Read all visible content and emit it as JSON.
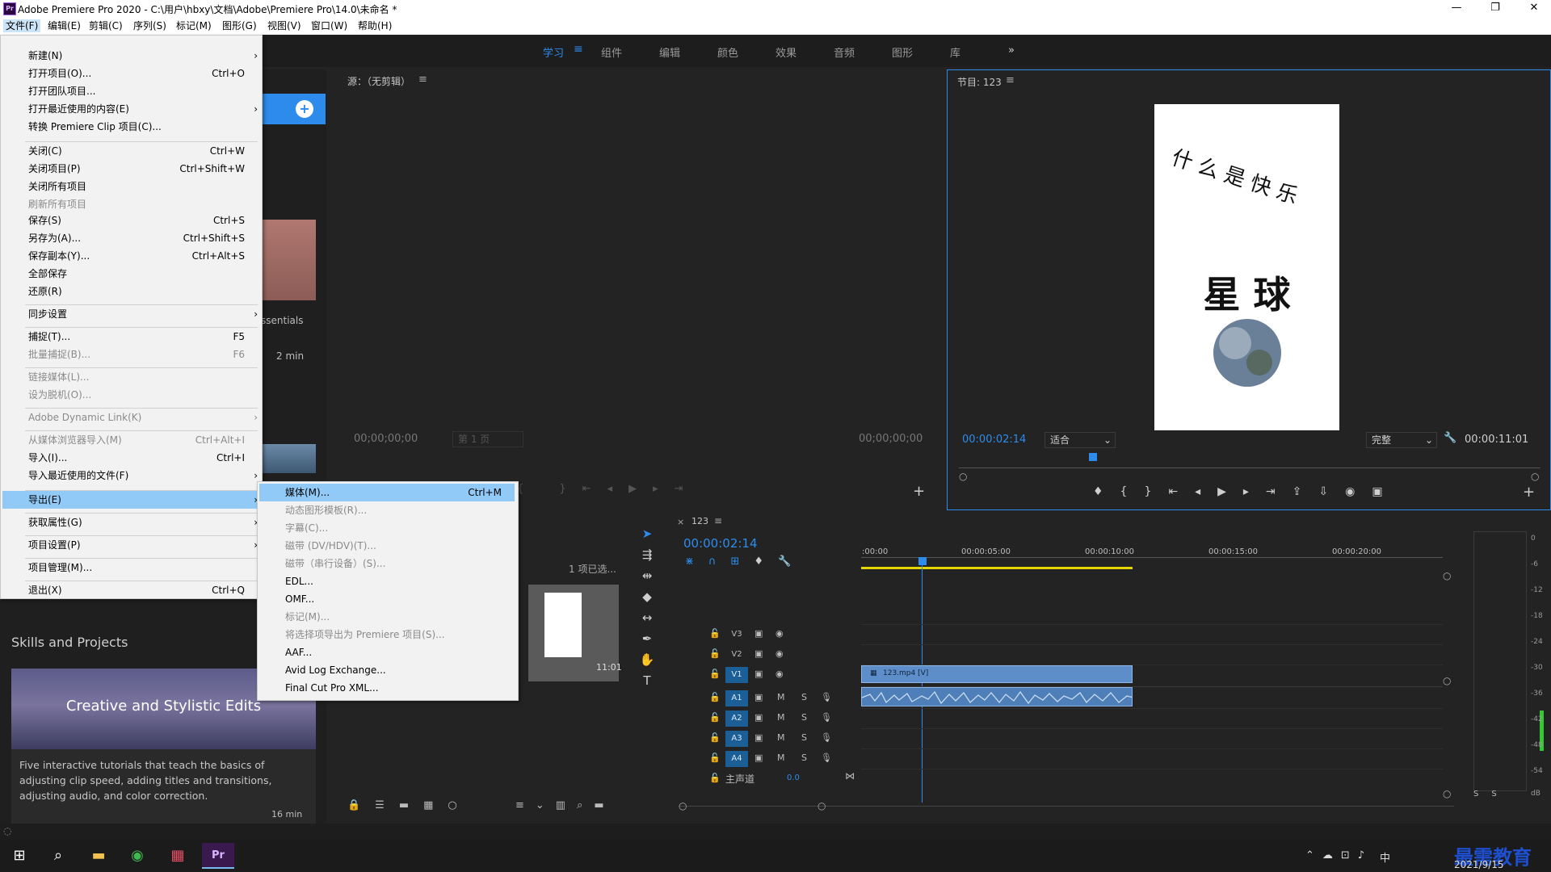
{
  "window": {
    "title": "Adobe Premiere Pro 2020 - C:\\用户\\hbxy\\文档\\Adobe\\Premiere Pro\\14.0\\未命名 *",
    "minimize": "—",
    "maximize": "❐",
    "close": "✕"
  },
  "menubar": [
    "文件(F)",
    "编辑(E)",
    "剪辑(C)",
    "序列(S)",
    "标记(M)",
    "图形(G)",
    "视图(V)",
    "窗口(W)",
    "帮助(H)"
  ],
  "workspaces": [
    "学习",
    "组件",
    "编辑",
    "颜色",
    "效果",
    "音频",
    "图形",
    "库"
  ],
  "workspace_more": "»",
  "file_menu": [
    {
      "label": "新建(N)",
      "shortcut": "",
      "submenu": true,
      "disabled": false
    },
    {
      "label": "打开项目(O)...",
      "shortcut": "Ctrl+O",
      "submenu": false,
      "disabled": false
    },
    {
      "label": "打开团队项目...",
      "shortcut": "",
      "submenu": false,
      "disabled": false
    },
    {
      "label": "打开最近使用的内容(E)",
      "shortcut": "",
      "submenu": true,
      "disabled": false
    },
    {
      "label": "转换 Premiere Clip 项目(C)...",
      "shortcut": "",
      "submenu": false,
      "disabled": false
    },
    {
      "label": "关闭(C)",
      "shortcut": "Ctrl+W",
      "submenu": false,
      "disabled": false
    },
    {
      "label": "关闭项目(P)",
      "shortcut": "Ctrl+Shift+W",
      "submenu": false,
      "disabled": false
    },
    {
      "label": "关闭所有项目",
      "shortcut": "",
      "submenu": false,
      "disabled": false
    },
    {
      "label": "刷新所有项目",
      "shortcut": "",
      "submenu": false,
      "disabled": true
    },
    {
      "label": "保存(S)",
      "shortcut": "Ctrl+S",
      "submenu": false,
      "disabled": false
    },
    {
      "label": "另存为(A)...",
      "shortcut": "Ctrl+Shift+S",
      "submenu": false,
      "disabled": false
    },
    {
      "label": "保存副本(Y)...",
      "shortcut": "Ctrl+Alt+S",
      "submenu": false,
      "disabled": false
    },
    {
      "label": "全部保存",
      "shortcut": "",
      "submenu": false,
      "disabled": false
    },
    {
      "label": "还原(R)",
      "shortcut": "",
      "submenu": false,
      "disabled": false
    },
    {
      "label": "同步设置",
      "shortcut": "",
      "submenu": true,
      "disabled": false
    },
    {
      "label": "捕捉(T)...",
      "shortcut": "F5",
      "submenu": false,
      "disabled": false
    },
    {
      "label": "批量捕捉(B)...",
      "shortcut": "F6",
      "submenu": false,
      "disabled": true
    },
    {
      "label": "链接媒体(L)...",
      "shortcut": "",
      "submenu": false,
      "disabled": true
    },
    {
      "label": "设为脱机(O)...",
      "shortcut": "",
      "submenu": false,
      "disabled": true
    },
    {
      "label": "Adobe Dynamic Link(K)",
      "shortcut": "",
      "submenu": true,
      "disabled": true
    },
    {
      "label": "从媒体浏览器导入(M)",
      "shortcut": "Ctrl+Alt+I",
      "submenu": false,
      "disabled": true
    },
    {
      "label": "导入(I)...",
      "shortcut": "Ctrl+I",
      "submenu": false,
      "disabled": false
    },
    {
      "label": "导入最近使用的文件(F)",
      "shortcut": "",
      "submenu": true,
      "disabled": false
    },
    {
      "label": "导出(E)",
      "shortcut": "",
      "submenu": true,
      "disabled": false
    },
    {
      "label": "获取属性(G)",
      "shortcut": "",
      "submenu": true,
      "disabled": false
    },
    {
      "label": "项目设置(P)",
      "shortcut": "",
      "submenu": true,
      "disabled": false
    },
    {
      "label": "项目管理(M)...",
      "shortcut": "",
      "submenu": false,
      "disabled": false
    },
    {
      "label": "退出(X)",
      "shortcut": "Ctrl+Q",
      "submenu": false,
      "disabled": false
    }
  ],
  "export_menu": [
    {
      "label": "媒体(M)...",
      "shortcut": "Ctrl+M",
      "disabled": false
    },
    {
      "label": "动态图形模板(R)...",
      "shortcut": "",
      "disabled": true
    },
    {
      "label": "字幕(C)...",
      "shortcut": "",
      "disabled": true
    },
    {
      "label": "磁带 (DV/HDV)(T)...",
      "shortcut": "",
      "disabled": true
    },
    {
      "label": "磁带（串行设备）(S)...",
      "shortcut": "",
      "disabled": true
    },
    {
      "label": "EDL...",
      "shortcut": "",
      "disabled": false
    },
    {
      "label": "OMF...",
      "shortcut": "",
      "disabled": false
    },
    {
      "label": "标记(M)...",
      "shortcut": "",
      "disabled": true
    },
    {
      "label": "将选择项导出为 Premiere 项目(S)...",
      "shortcut": "",
      "disabled": true
    },
    {
      "label": "AAF...",
      "shortcut": "",
      "disabled": false
    },
    {
      "label": "Avid Log Exchange...",
      "shortcut": "",
      "disabled": false
    },
    {
      "label": "Final Cut Pro XML...",
      "shortcut": "",
      "disabled": false
    }
  ],
  "learn_panel": {
    "essentials_fragment": "ssentials",
    "duration_fragment": "2 min",
    "section_title": "Skills and Projects",
    "card_title": "Creative and Stylistic Edits",
    "card_desc": "Five interactive tutorials that teach the basics of adjusting clip speed, adding titles and transitions, adjusting audio, and color correction.",
    "card_duration": "16 min"
  },
  "source_monitor": {
    "title": "源：（无剪辑）",
    "tc_left": "00;00;00;00",
    "page": "第 1 页",
    "tc_right": "00;00;00;00"
  },
  "program_monitor": {
    "title": "节目: 123",
    "timecode": "00:00:02:14",
    "fit": "适合",
    "quality": "完整",
    "duration": "00:00:11:01",
    "frame_text_top": "什么是快乐",
    "frame_text_main": "星 球",
    "playhead_fraction": 0.224
  },
  "project_panel": {
    "items_text": "1 项已选...",
    "thumb_duration": "11:01"
  },
  "timeline": {
    "tab": "123",
    "timecode": "00:00:02:14",
    "ruler": [
      ":00:00",
      "00:00:05:00",
      "00:00:10:00",
      "00:00:15:00",
      "00:00:20:00"
    ],
    "video_tracks": [
      "V3",
      "V2",
      "V1"
    ],
    "audio_tracks": [
      "A1",
      "A2",
      "A3",
      "A4"
    ],
    "master_label": "主声道",
    "master_value": "0.0",
    "clip_label": "123.mp4 [V]"
  },
  "audio_meter": {
    "ticks": [
      "0",
      "-6",
      "-12",
      "-18",
      "-24",
      "-30",
      "-36",
      "-42",
      "-48",
      "-54",
      "dB"
    ],
    "solo": [
      "S",
      "S"
    ]
  },
  "taskbar": {
    "date": "2021/9/15",
    "ime": "中",
    "watermark": "最需教育"
  },
  "colors": {
    "accent": "#2d8ceb",
    "menu_highlight": "#91c9f7",
    "clip_video": "#5e8ec9",
    "clip_audio": "#4f7fb8"
  }
}
